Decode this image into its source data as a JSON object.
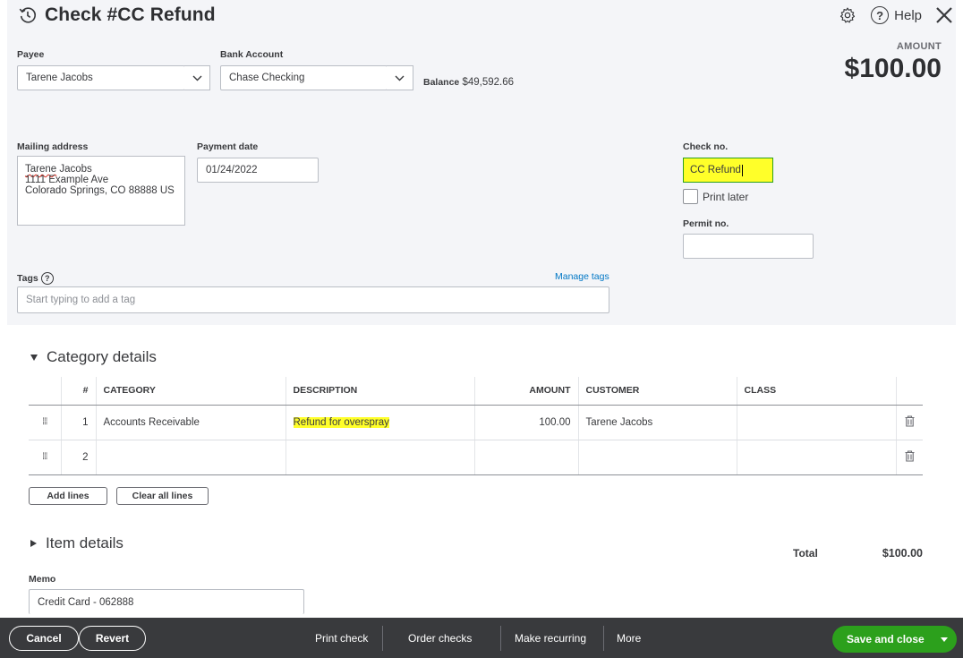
{
  "header": {
    "title": "Check #CC Refund",
    "help_label": "Help",
    "amount_label": "AMOUNT",
    "amount_value": "$100.00"
  },
  "payee": {
    "label": "Payee",
    "value": "Tarene Jacobs"
  },
  "bank_account": {
    "label": "Bank Account",
    "value": "Chase Checking",
    "balance_label": "Balance",
    "balance_value": "$49,592.66"
  },
  "mailing_address": {
    "label": "Mailing address",
    "name": "Tarene",
    "name_rest": " Jacobs",
    "line2": "1111 Example Ave",
    "line3": "Colorado Springs, CO  88888 US"
  },
  "payment_date": {
    "label": "Payment date",
    "value": "01/24/2022"
  },
  "check_no": {
    "label": "Check no.",
    "value": "CC Refund"
  },
  "print_later": {
    "label": "Print later",
    "checked": false
  },
  "permit_no": {
    "label": "Permit no.",
    "value": ""
  },
  "tags": {
    "label": "Tags",
    "placeholder": "Start typing to add a tag",
    "manage_label": "Manage tags"
  },
  "category_details": {
    "title": "Category details",
    "columns": [
      "#",
      "CATEGORY",
      "DESCRIPTION",
      "AMOUNT",
      "CUSTOMER",
      "CLASS"
    ],
    "rows": [
      {
        "num": "1",
        "category": "Accounts Receivable",
        "description": "Refund for overspray",
        "amount": "100.00",
        "customer": "Tarene Jacobs",
        "class": ""
      },
      {
        "num": "2",
        "category": "",
        "description": "",
        "amount": "",
        "customer": "",
        "class": ""
      }
    ],
    "add_lines_label": "Add lines",
    "clear_lines_label": "Clear all lines"
  },
  "item_details": {
    "title": "Item details"
  },
  "total": {
    "label": "Total",
    "value": "$100.00"
  },
  "memo": {
    "label": "Memo",
    "value": "Credit Card - 062888"
  },
  "footer": {
    "cancel": "Cancel",
    "revert": "Revert",
    "print_check": "Print check",
    "order_checks": "Order checks",
    "make_recurring": "Make recurring",
    "more": "More",
    "save_close": "Save and close"
  },
  "colors": {
    "accent_green": "#2ca01c",
    "highlight_yellow": "#ffff29",
    "link_blue": "#0077c5",
    "footer_bg": "#393a3d"
  },
  "icons": [
    "history-icon",
    "gear-icon",
    "help-icon",
    "close-icon",
    "chevron-down-icon",
    "drag-handle-icon",
    "trash-icon",
    "triangle-down-icon",
    "triangle-right-icon"
  ]
}
